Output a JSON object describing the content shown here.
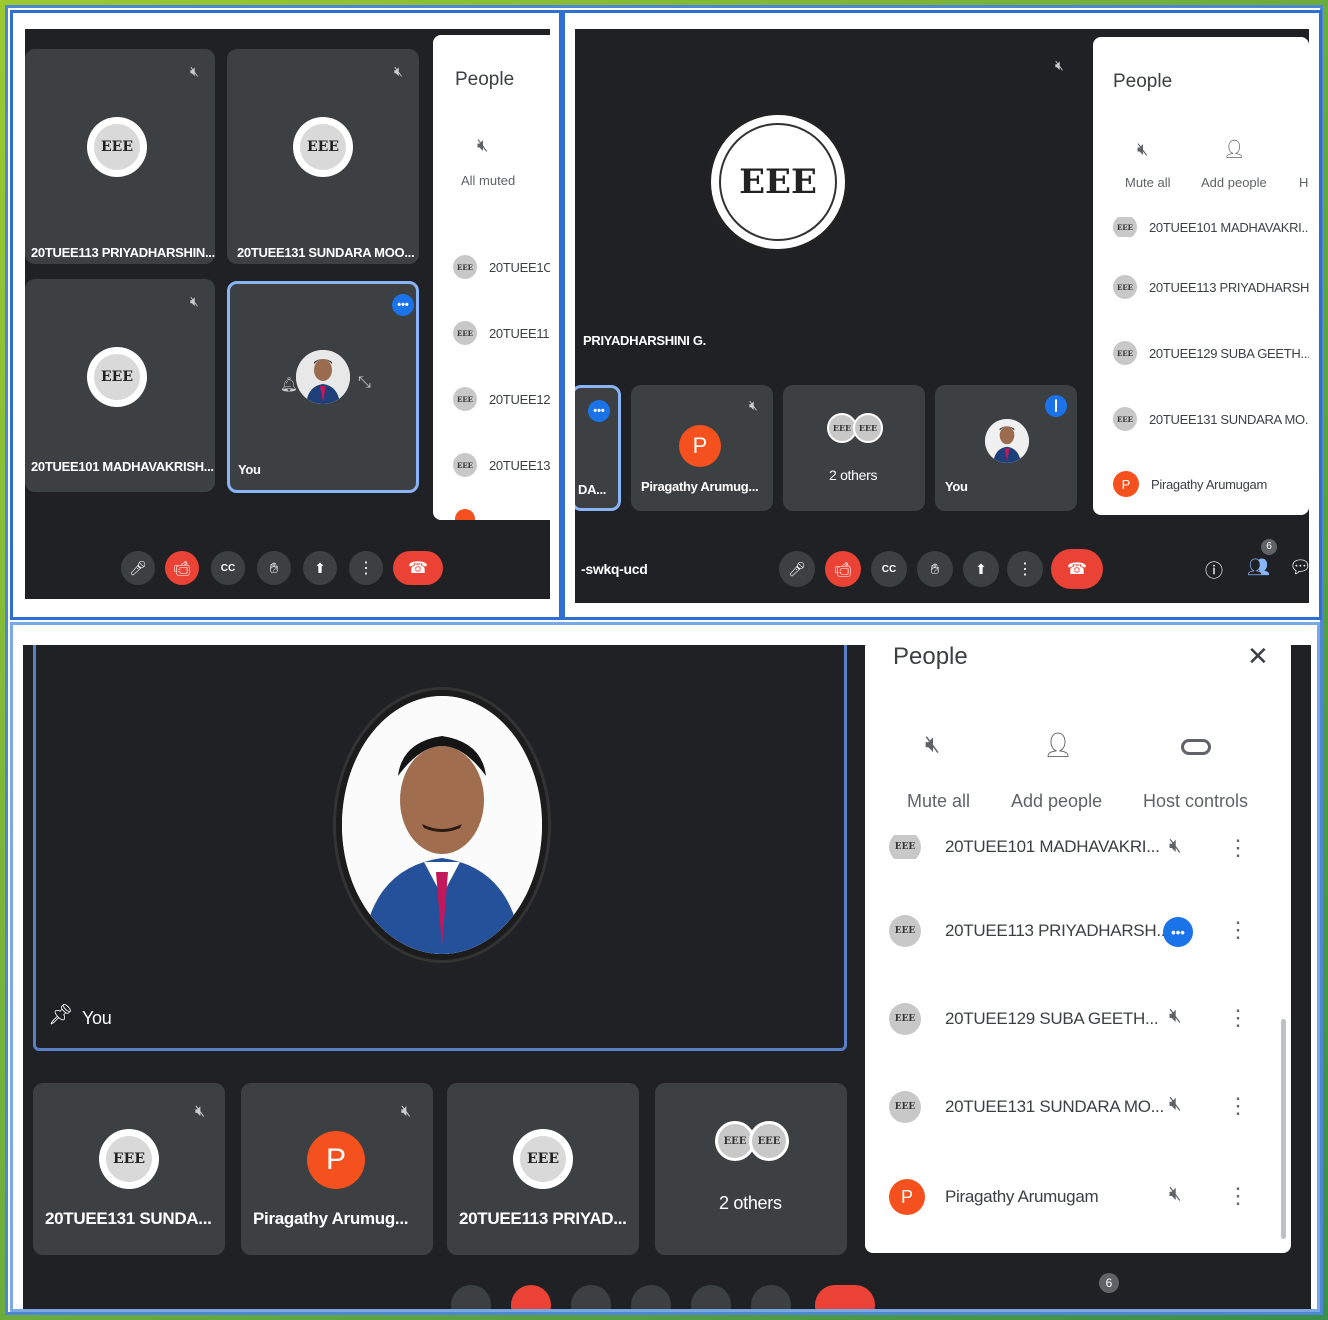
{
  "panel1": {
    "tiles": [
      {
        "name": "20TUEE113 PRIYADHARSHIN..."
      },
      {
        "name": "20TUEE131 SUNDARA MOO..."
      },
      {
        "name": "20TUEE101 MADHAVAKRISH..."
      },
      {
        "name": "You"
      }
    ],
    "people": {
      "title": "People",
      "muted_label": "All muted",
      "rows": [
        "20TUEE1C",
        "20TUEE11",
        "20TUEE12",
        "20TUEE13"
      ]
    }
  },
  "panel2": {
    "main_name": "PRIYADHARSHINI G.",
    "meeting_code": "-swkq-ucd",
    "tiles": [
      {
        "name": "DA..."
      },
      {
        "name": "Piragathy Arumug..."
      },
      {
        "name": "2 others"
      },
      {
        "name": "You"
      }
    ],
    "avatar_letter": "P",
    "participant_count": "6",
    "people": {
      "title": "People",
      "mute_all": "Mute all",
      "add_people": "Add people",
      "host_partial": "H",
      "rows": [
        "20TUEE101 MADHAVAKRI...",
        "20TUEE113 PRIYADHARSH...",
        "20TUEE129 SUBA GEETH...",
        "20TUEE131 SUNDARA MO...",
        "Piragathy Arumugam"
      ]
    }
  },
  "panel3": {
    "main_name": "You",
    "avatar_letter": "P",
    "participant_count": "6",
    "tiles": [
      {
        "name": "20TUEE131 SUNDA..."
      },
      {
        "name": "Piragathy Arumug..."
      },
      {
        "name": "20TUEE113 PRIYAD..."
      },
      {
        "name": "2 others"
      }
    ],
    "people": {
      "title": "People",
      "mute_all": "Mute all",
      "add_people": "Add people",
      "host_controls": "Host controls",
      "rows": [
        "20TUEE101 MADHAVAKRI...",
        "20TUEE113 PRIYADHARSH...",
        "20TUEE129 SUBA GEETH...",
        "20TUEE131 SUNDARA MO...",
        "Piragathy Arumugam"
      ]
    }
  },
  "logo_text": "EEE",
  "colors": {
    "meet_bg": "#202124",
    "tile": "#3c4043",
    "red": "#ea4335",
    "blue": "#1a73e8",
    "orange": "#f4511e"
  }
}
